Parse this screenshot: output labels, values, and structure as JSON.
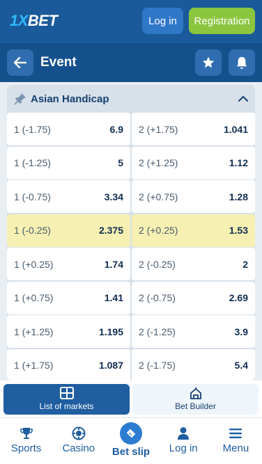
{
  "header": {
    "logo_main": "1X",
    "logo_tail": "BET",
    "login_label": "Log in",
    "registration_label": "Registration"
  },
  "eventbar": {
    "title": "Event"
  },
  "market": {
    "title": "Asian Handicap",
    "rows": [
      {
        "l1": "1 (-1.75)",
        "o1": "6.9",
        "l2": "2 (+1.75)",
        "o2": "1.041"
      },
      {
        "l1": "1 (-1.25)",
        "o1": "5",
        "l2": "2 (+1.25)",
        "o2": "1.12"
      },
      {
        "l1": "1 (-0.75)",
        "o1": "3.34",
        "l2": "2 (+0.75)",
        "o2": "1.28"
      },
      {
        "l1": "1 (-0.25)",
        "o1": "2.375",
        "l2": "2 (+0.25)",
        "o2": "1.53"
      },
      {
        "l1": "1 (+0.25)",
        "o1": "1.74",
        "l2": "2 (-0.25)",
        "o2": "2"
      },
      {
        "l1": "1 (+0.75)",
        "o1": "1.41",
        "l2": "2 (-0.75)",
        "o2": "2.69"
      },
      {
        "l1": "1 (+1.25)",
        "o1": "1.195",
        "l2": "2 (-1.25)",
        "o2": "3.9"
      },
      {
        "l1": "1 (+1.75)",
        "o1": "1.087",
        "l2": "2 (-1.75)",
        "o2": "5.4"
      }
    ]
  },
  "tabs": {
    "list_of_markets": "List of markets",
    "bet_builder": "Bet Builder"
  },
  "bottomnav": {
    "sports": "Sports",
    "casino": "Casino",
    "bet_slip": "Bet slip",
    "log_in": "Log in",
    "menu": "Menu"
  }
}
